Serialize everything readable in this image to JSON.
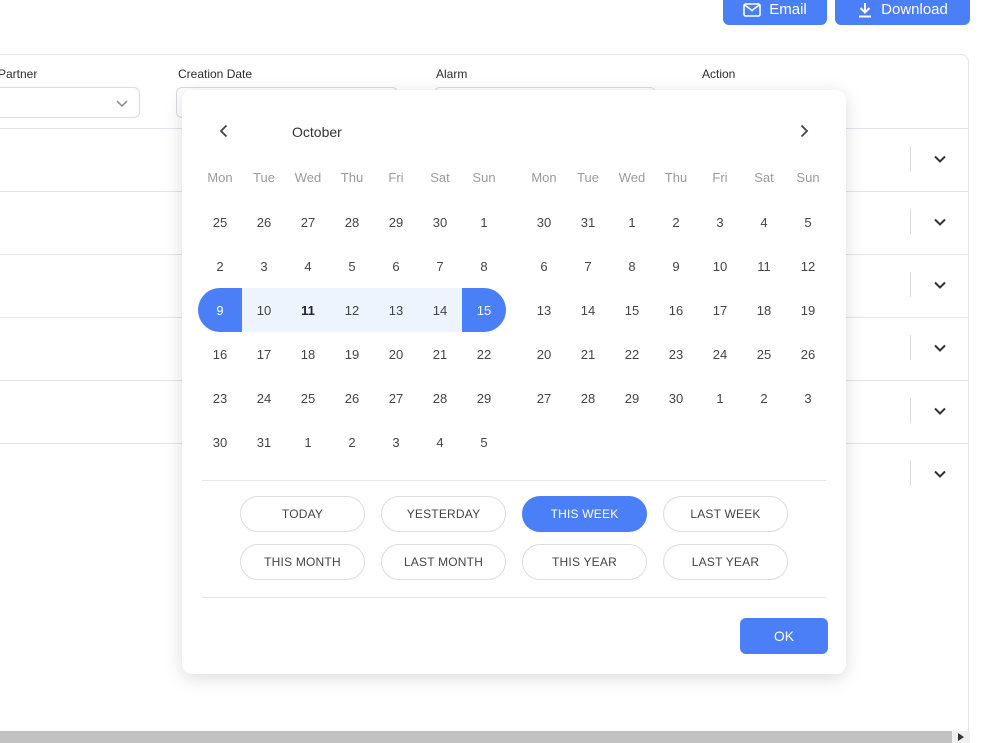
{
  "toolbar": {
    "email_label": "Email",
    "download_label": "Download"
  },
  "table": {
    "columns": [
      "Partner",
      "Creation Date",
      "Alarm",
      "Action"
    ],
    "row_count": 6
  },
  "datepicker": {
    "month_label": "October",
    "weekdays": [
      "Mon",
      "Tue",
      "Wed",
      "Thu",
      "Fri",
      "Sat",
      "Sun"
    ],
    "left_month": [
      [
        "25",
        "26",
        "27",
        "28",
        "29",
        "30",
        "1"
      ],
      [
        "2",
        "3",
        "4",
        "5",
        "6",
        "7",
        "8"
      ],
      [
        "9",
        "10",
        "11",
        "12",
        "13",
        "14",
        "15"
      ],
      [
        "16",
        "17",
        "18",
        "19",
        "20",
        "21",
        "22"
      ],
      [
        "23",
        "24",
        "25",
        "26",
        "27",
        "28",
        "29"
      ],
      [
        "30",
        "31",
        "1",
        "2",
        "3",
        "4",
        "5"
      ]
    ],
    "right_month": [
      [
        "30",
        "31",
        "1",
        "2",
        "3",
        "4",
        "5"
      ],
      [
        "6",
        "7",
        "8",
        "9",
        "10",
        "11",
        "12"
      ],
      [
        "13",
        "14",
        "15",
        "16",
        "17",
        "18",
        "19"
      ],
      [
        "20",
        "21",
        "22",
        "23",
        "24",
        "25",
        "26"
      ],
      [
        "27",
        "28",
        "29",
        "30",
        "1",
        "2",
        "3"
      ]
    ],
    "selected_range": {
      "start": "9",
      "end": "15"
    },
    "today": "11",
    "presets": [
      {
        "label": "TODAY",
        "active": false
      },
      {
        "label": "YESTERDAY",
        "active": false
      },
      {
        "label": "THIS WEEK",
        "active": true
      },
      {
        "label": "LAST WEEK",
        "active": false
      },
      {
        "label": "THIS MONTH",
        "active": false
      },
      {
        "label": "LAST MONTH",
        "active": false
      },
      {
        "label": "THIS YEAR",
        "active": false
      },
      {
        "label": "LAST YEAR",
        "active": false
      }
    ],
    "ok_label": "OK"
  },
  "colors": {
    "accent": "#4a7ff7",
    "range_fill": "#eef4fe",
    "border": "#e1e4ea"
  }
}
